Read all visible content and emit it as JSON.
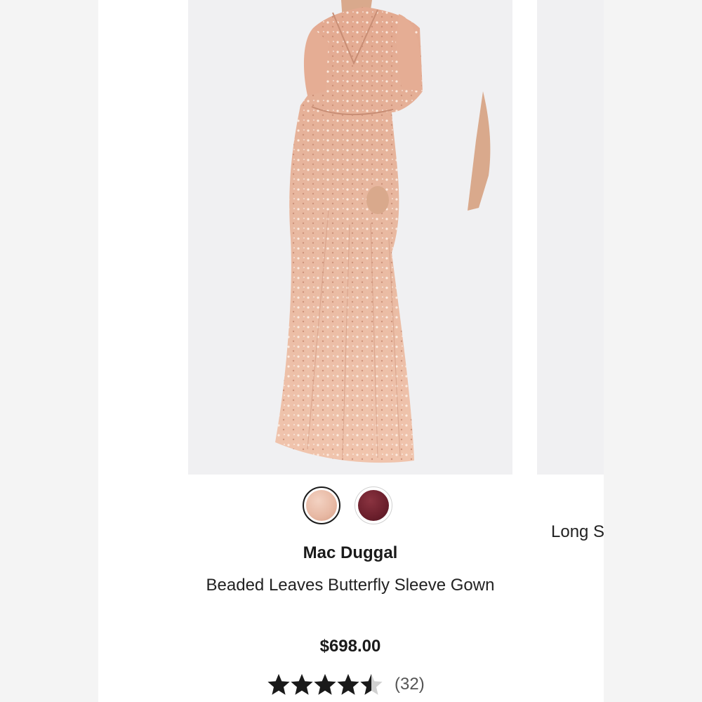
{
  "product": {
    "brand": "Mac Duggal",
    "name": "Beaded Leaves Butterfly Sleeve Gown",
    "price": "$698.00",
    "rating": 4.5,
    "review_count": "(32)",
    "image": {
      "alt": "Blush beaded gown with butterfly sleeves",
      "background_color": "#f0f0f2",
      "dress_color": "#e8b8a0"
    },
    "swatches": [
      {
        "name": "Blush",
        "color": "#e7b8a3",
        "selected": true
      },
      {
        "name": "Burgundy",
        "color": "#6b1f2c",
        "selected": false
      }
    ]
  },
  "next_product": {
    "title_partial": "Long S"
  }
}
